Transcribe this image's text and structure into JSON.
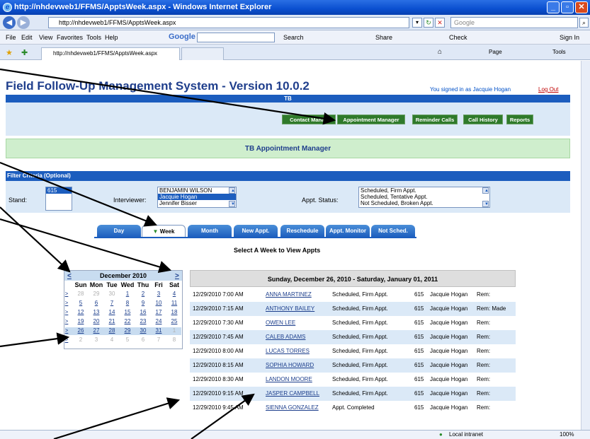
{
  "window": {
    "title": "http://nhdevweb1/FFMS/ApptsWeek.aspx - Windows Internet Explorer",
    "address": "http://nhdevweb1/FFMS/ApptsWeek.aspx",
    "search_placeholder": "Google",
    "tab_title": "http://nhdevweb1/FFMS/ApptsWeek.aspx"
  },
  "menu": {
    "items": [
      "File",
      "Edit",
      "View",
      "Favorites",
      "Tools",
      "Help"
    ],
    "google_label": "Google",
    "search_btn": "Search",
    "share_btn": "Share",
    "check_btn": "Check",
    "signin_btn": "Sign In",
    "page_btn": "Page",
    "tools_btn": "Tools"
  },
  "app": {
    "title": "Field Follow-Up Management System - Version 10.0.2",
    "signed_in": "You signed in as Jacquie Hogan",
    "logout": "Log Out",
    "program": "TB",
    "nav": [
      "Contact Manag",
      "Appointment Manager",
      "Reminder Calls",
      "Call History",
      "Reports"
    ],
    "page_heading": "TB Appointment Manager"
  },
  "filter": {
    "header": "Filter Criteria (Optional)",
    "stand_label": "Stand:",
    "stand_options": [
      "615"
    ],
    "interviewer_label": "Interviewer:",
    "interviewer_options": [
      "BENJAMIN WILSON",
      "Jacquie Hogan",
      "Jennifer Bisser"
    ],
    "status_label": "Appt. Status:",
    "status_options": [
      "Scheduled, Firm Appt.",
      "Scheduled, Tentative Appt.",
      "Not Scheduled, Broken Appt."
    ]
  },
  "view_tabs": [
    "Day",
    "Week",
    "Month",
    "New Appt.",
    "Reschedule",
    "Appt. Monitor",
    "Not Sched."
  ],
  "select_week_text": "Select A Week to View Appts",
  "calendar": {
    "prev": "<",
    "next": ">",
    "month": "December 2010",
    "weekday_headers": [
      "Sun",
      "Mon",
      "Tue",
      "Wed",
      "Thu",
      "Fri",
      "Sat"
    ],
    "week_selector": ">",
    "weeks": [
      [
        "28",
        "29",
        "30",
        "1",
        "2",
        "3",
        "4"
      ],
      [
        "5",
        "6",
        "7",
        "8",
        "9",
        "10",
        "11"
      ],
      [
        "12",
        "13",
        "14",
        "15",
        "16",
        "17",
        "18"
      ],
      [
        "19",
        "20",
        "21",
        "22",
        "23",
        "24",
        "25"
      ],
      [
        "26",
        "27",
        "28",
        "29",
        "30",
        "31",
        "1"
      ],
      [
        "2",
        "3",
        "4",
        "5",
        "6",
        "7",
        "8"
      ]
    ]
  },
  "appointments": {
    "range": "Sunday, December 26, 2010 - Saturday, January 01, 2011",
    "rows": [
      {
        "time": "12/29/2010 7:00 AM",
        "name": "ANNA MARTINEZ",
        "status": "Scheduled, Firm Appt.",
        "stand": "615",
        "interviewer": "Jacquie Hogan",
        "rem": "Rem:"
      },
      {
        "time": "12/29/2010 7:15 AM",
        "name": "ANTHONY BAILEY",
        "status": "Scheduled, Firm Appt.",
        "stand": "615",
        "interviewer": "Jacquie Hogan",
        "rem": "Rem: Made"
      },
      {
        "time": "12/29/2010 7:30 AM",
        "name": "OWEN LEE",
        "status": "Scheduled, Firm Appt.",
        "stand": "615",
        "interviewer": "Jacquie Hogan",
        "rem": "Rem:"
      },
      {
        "time": "12/29/2010 7:45 AM",
        "name": "CALEB ADAMS",
        "status": "Scheduled, Firm Appt.",
        "stand": "615",
        "interviewer": "Jacquie Hogan",
        "rem": "Rem:"
      },
      {
        "time": "12/29/2010 8:00 AM",
        "name": "LUCAS TORRES",
        "status": "Scheduled, Firm Appt.",
        "stand": "615",
        "interviewer": "Jacquie Hogan",
        "rem": "Rem:"
      },
      {
        "time": "12/29/2010 8:15 AM",
        "name": "SOPHIA HOWARD",
        "status": "Scheduled, Firm Appt.",
        "stand": "615",
        "interviewer": "Jacquie Hogan",
        "rem": "Rem:"
      },
      {
        "time": "12/29/2010 8:30 AM",
        "name": "LANDON MOORE",
        "status": "Scheduled, Firm Appt.",
        "stand": "615",
        "interviewer": "Jacquie Hogan",
        "rem": "Rem:"
      },
      {
        "time": "12/29/2010 9:15 AM",
        "name": "JASPER CAMPBELL",
        "status": "Scheduled, Firm Appt.",
        "stand": "615",
        "interviewer": "Jacquie Hogan",
        "rem": "Rem:"
      },
      {
        "time": "12/29/2010 9:45 AM",
        "name": "SIENNA GONZALEZ",
        "status": "Appt. Completed",
        "stand": "615",
        "interviewer": "Jacquie Hogan",
        "rem": "Rem:"
      }
    ]
  },
  "statusbar": {
    "zone": "Local intranet",
    "zoom": "100%"
  }
}
